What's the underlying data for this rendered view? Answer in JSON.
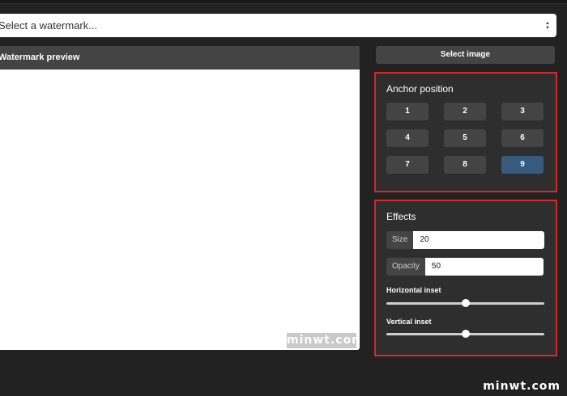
{
  "watermark_select": {
    "value": "Select a watermark...",
    "arrow_icon": "updown-arrow-icon"
  },
  "preview": {
    "title": "Watermark preview",
    "watermark_text": "minwt.com"
  },
  "select_image_label": "Select image",
  "anchor": {
    "title": "Anchor position",
    "selected": "9",
    "buttons": [
      "1",
      "2",
      "3",
      "4",
      "5",
      "6",
      "7",
      "8",
      "9"
    ],
    "active_color": "#375a7f"
  },
  "effects": {
    "title": "Effects",
    "size_label": "Size",
    "size_value": "20",
    "opacity_label": "Opacity",
    "opacity_value": "50",
    "horizontal_inset_label": "Horizontal inset",
    "horizontal_inset_level": 0.5,
    "vertical_inset_label": "Vertical inset",
    "vertical_inset_level": 0.5
  },
  "brand_text": "minwt.com",
  "highlight_color": "#d42a2a"
}
